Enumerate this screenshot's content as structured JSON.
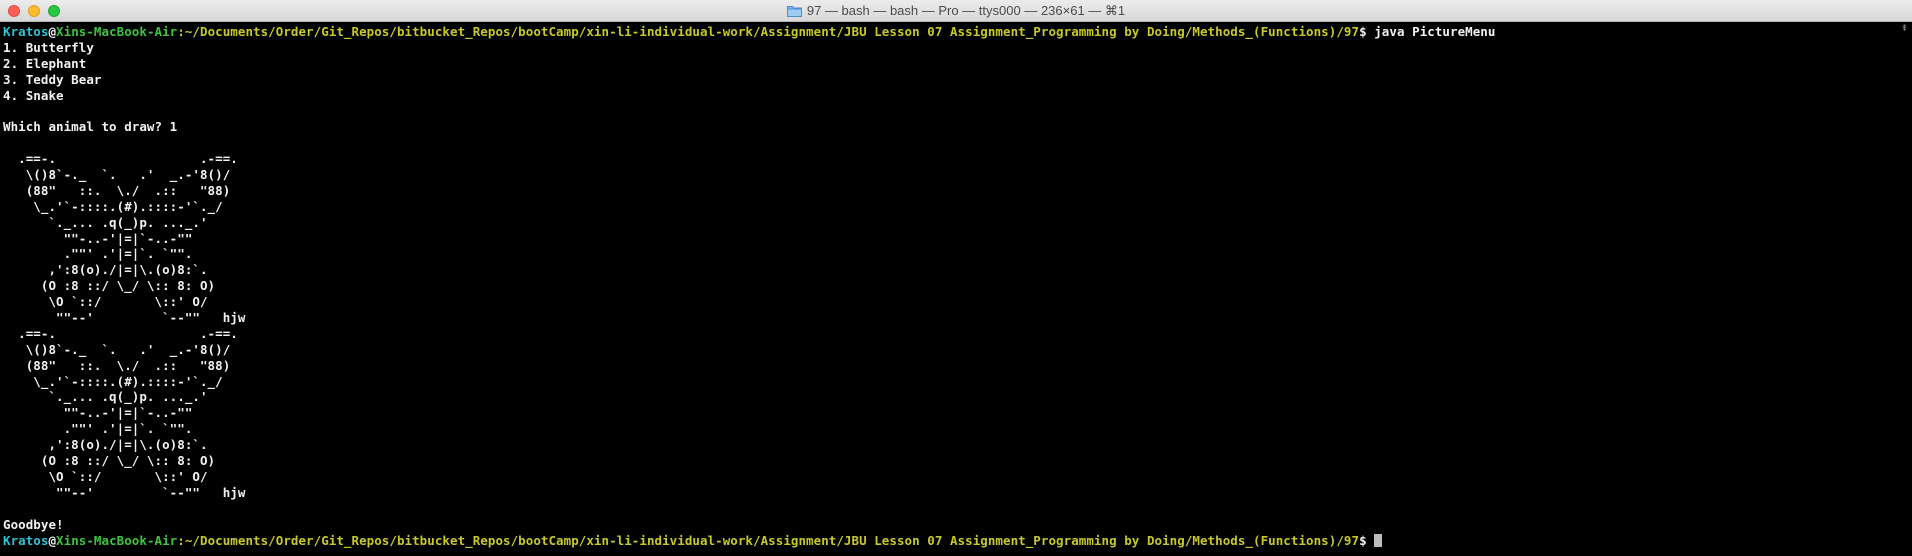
{
  "window": {
    "title": "97 — bash — bash — Pro — ttys000 — 236×61 — ⌘1"
  },
  "prompt": {
    "user": "Kratos",
    "at": "@",
    "host": "Xins-MacBook-Air",
    "path": ":~/Documents/Order/Git_Repos/bitbucket_Repos/bootCamp/xin-li-individual-work/Assignment/JBU Lesson 07 Assignment_Programming by Doing/Methods_(Functions)/97",
    "symbol": "$ "
  },
  "command": "java PictureMenu",
  "menu": [
    "1. Butterfly",
    "2. Elephant",
    "3. Teddy Bear",
    "4. Snake"
  ],
  "blank": "",
  "question": "Which animal to draw? 1",
  "art_first": [
    "  .==-.                   .-==.",
    "   \\()8`-._  `.   .'  _.-'8()/",
    "   (88\"   ::.  \\./  .::   \"88)",
    "    \\_.'`-::::.(#).::::-'`._/",
    "      `._... .q(_)p. ..._.'",
    "        \"\"-..-'|=|`-..-\"\"",
    "        .\"\"' .'|=|`. `\"\".",
    "      ,':8(o)./|=|\\.(o)8:`.",
    "     (O :8 ::/ \\_/ \\:: 8: O)",
    "      \\O `::/       \\::' O/",
    "       \"\"--'         `--\"\"   hjw"
  ],
  "art_second": [
    "  .==-.                   .-==.",
    "   \\()8`-._  `.   .'  _.-'8()/",
    "   (88\"   ::.  \\./  .::   \"88)",
    "    \\_.'`-::::.(#).::::-'`._/",
    "      `._... .q(_)p. ..._.'",
    "        \"\"-..-'|=|`-..-\"\"",
    "        .\"\"' .'|=|`. `\"\".",
    "      ,':8(o)./|=|\\.(o)8:`.",
    "     (O :8 ::/ \\_/ \\:: 8: O)",
    "      \\O `::/       \\::' O/",
    "       \"\"--'         `--\"\"   hjw"
  ],
  "goodbye": "Goodbye!",
  "colors": {
    "user": "#2fc3d4",
    "host": "#3fc33f",
    "path": "#c8c82a",
    "text": "#f2f2f2",
    "background": "#000000"
  },
  "icons": {
    "folder": "folder-icon",
    "scroll_up": "scroll-up-arrow-icon"
  }
}
